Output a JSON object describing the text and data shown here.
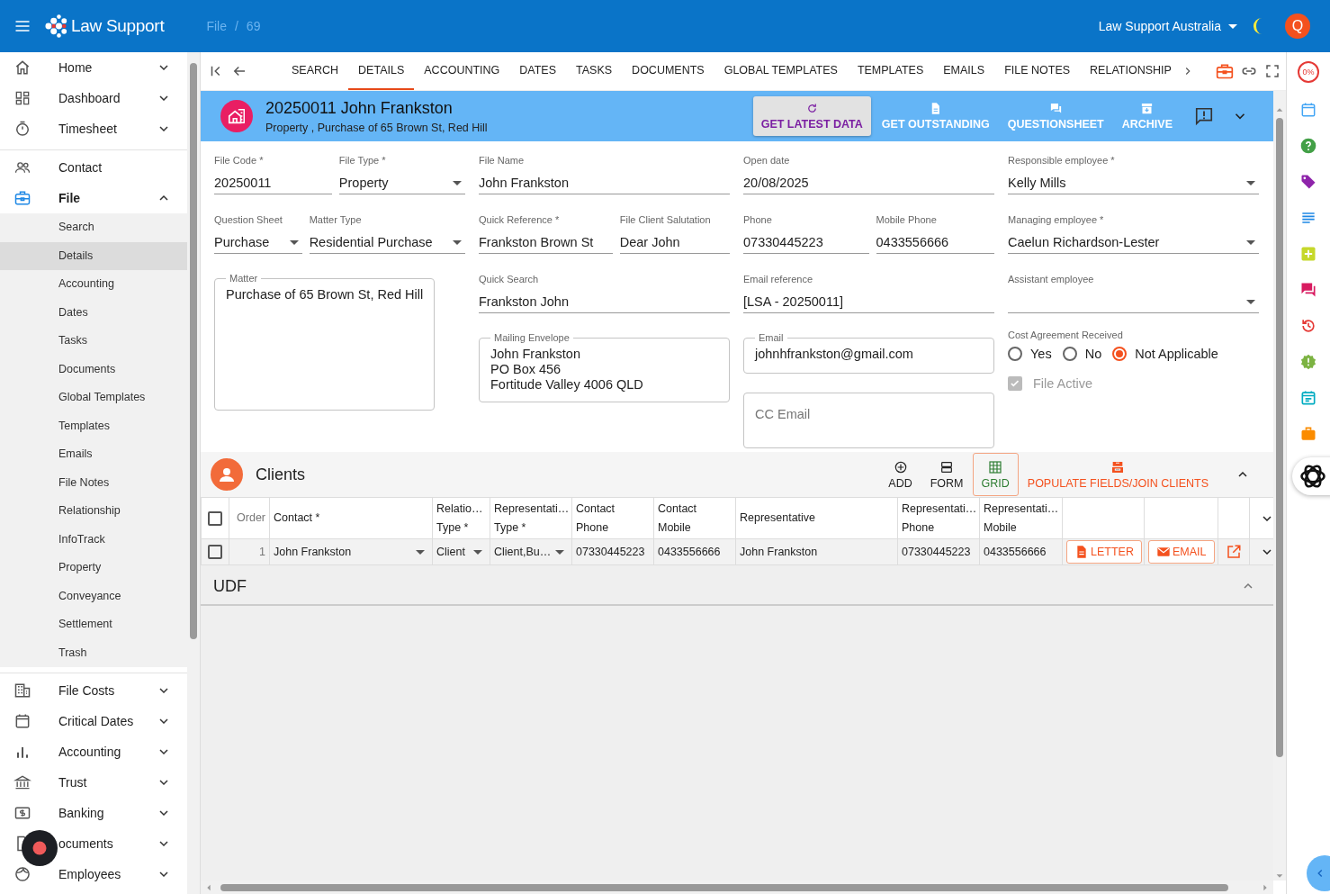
{
  "header": {
    "brand": "Law Support",
    "breadcrumb": [
      "File",
      "69"
    ],
    "separator": "/",
    "organization": "Law Support Australia",
    "avatar": "Q"
  },
  "sidebar": {
    "items": [
      {
        "label": "Home",
        "kind": "group",
        "expanded": false
      },
      {
        "label": "Dashboard",
        "kind": "group",
        "expanded": false
      },
      {
        "label": "Timesheet",
        "kind": "group",
        "expanded": false
      },
      {
        "label": "Contact",
        "kind": "link"
      },
      {
        "label": "File",
        "kind": "group",
        "expanded": true,
        "children": [
          {
            "label": "Search",
            "selected": false
          },
          {
            "label": "Details",
            "selected": true
          },
          {
            "label": "Accounting",
            "selected": false
          },
          {
            "label": "Dates",
            "selected": false
          },
          {
            "label": "Tasks",
            "selected": false
          },
          {
            "label": "Documents",
            "selected": false
          },
          {
            "label": "Global Templates",
            "selected": false
          },
          {
            "label": "Templates",
            "selected": false
          },
          {
            "label": "Emails",
            "selected": false
          },
          {
            "label": "File Notes",
            "selected": false
          },
          {
            "label": "Relationship",
            "selected": false
          },
          {
            "label": "InfoTrack",
            "selected": false
          },
          {
            "label": "Property",
            "selected": false
          },
          {
            "label": "Conveyance",
            "selected": false
          },
          {
            "label": "Settlement",
            "selected": false
          },
          {
            "label": "Trash",
            "selected": false
          }
        ]
      },
      {
        "label": "File Costs",
        "kind": "group",
        "expanded": false
      },
      {
        "label": "Critical Dates",
        "kind": "group",
        "expanded": false
      },
      {
        "label": "Accounting",
        "kind": "group",
        "expanded": false
      },
      {
        "label": "Trust",
        "kind": "group",
        "expanded": false
      },
      {
        "label": "Banking",
        "kind": "group",
        "expanded": false
      },
      {
        "label": "ocuments",
        "kind": "group",
        "expanded": false
      },
      {
        "label": "Employees",
        "kind": "group",
        "expanded": false
      }
    ]
  },
  "tabs": [
    {
      "label": "SEARCH",
      "selected": false
    },
    {
      "label": "DETAILS",
      "selected": true
    },
    {
      "label": "ACCOUNTING",
      "selected": false
    },
    {
      "label": "DATES",
      "selected": false
    },
    {
      "label": "TASKS",
      "selected": false
    },
    {
      "label": "DOCUMENTS",
      "selected": false
    },
    {
      "label": "GLOBAL TEMPLATES",
      "selected": false
    },
    {
      "label": "TEMPLATES",
      "selected": false
    },
    {
      "label": "EMAILS",
      "selected": false
    },
    {
      "label": "FILE NOTES",
      "selected": false
    },
    {
      "label": "RELATIONSHIP",
      "selected": false
    }
  ],
  "banner": {
    "title": "20250011 John Frankston",
    "subtitle": "Property , Purchase of 65 Brown St, Red Hill",
    "actions": [
      {
        "label": "GET LATEST DATA",
        "active": true
      },
      {
        "label": "GET OUTSTANDING",
        "active": false
      },
      {
        "label": "QUESTIONSHEET",
        "active": false
      },
      {
        "label": "ARCHIVE",
        "active": false
      }
    ]
  },
  "form": {
    "columns": [
      [
        [
          {
            "kind": "text",
            "label": "File Code *",
            "value": "20250011"
          },
          {
            "kind": "select",
            "label": "File Type *",
            "value": "Property"
          }
        ],
        [
          {
            "kind": "select",
            "label": "Question Sheet",
            "value": "Purchase"
          },
          {
            "kind": "select",
            "label": "Matter Type",
            "value": "Residential Purchase"
          }
        ],
        [
          {
            "kind": "textarea",
            "label": "Matter",
            "value": "Purchase of 65 Brown St, Red Hill"
          }
        ]
      ],
      [
        [
          {
            "kind": "text",
            "label": "File Name",
            "value": "John Frankston"
          }
        ],
        [
          {
            "kind": "text",
            "label": "Quick Reference *",
            "value": "Frankston Brown St"
          },
          {
            "kind": "text",
            "label": "File Client Salutation",
            "value": "Dear John"
          }
        ],
        [
          {
            "kind": "text",
            "label": "Quick Search",
            "value": "Frankston John"
          }
        ],
        [
          {
            "kind": "outlined",
            "label": "Mailing Envelope",
            "value": "John Frankston\nPO Box 456\nFortitude Valley 4006 QLD"
          }
        ]
      ],
      [
        [
          {
            "kind": "text",
            "label": "Open date",
            "value": "20/08/2025"
          }
        ],
        [
          {
            "kind": "text",
            "label": "Phone",
            "value": "07330445223"
          },
          {
            "kind": "text",
            "label": "Mobile Phone",
            "value": "0433556666"
          }
        ],
        [
          {
            "kind": "text",
            "label": "Email reference",
            "value": "[LSA - 20250011]"
          }
        ],
        [
          {
            "kind": "outlined",
            "label": "Email",
            "value": "johnhfrankston@gmail.com"
          }
        ],
        [
          {
            "kind": "outlined",
            "placeholder": "CC Email"
          }
        ]
      ],
      [
        [
          {
            "kind": "select",
            "label": "Responsible employee *",
            "value": "Kelly Mills"
          }
        ],
        [
          {
            "kind": "select",
            "label": "Managing employee *",
            "value": "Caelun Richardson-Lester"
          }
        ],
        [
          {
            "kind": "select",
            "label": "Assistant employee"
          }
        ],
        [
          {
            "kind": "radio",
            "label": "Cost Agreement Received",
            "options": [
              {
                "label": "Yes",
                "selected": false
              },
              {
                "label": "No",
                "selected": false
              },
              {
                "label": "Not Applicable",
                "selected": true
              }
            ]
          }
        ],
        [
          {
            "kind": "checkbox",
            "label": "File Active",
            "checked": true,
            "disabled": true
          }
        ]
      ]
    ]
  },
  "clients": {
    "title": "Clients",
    "actions": [
      {
        "label": "ADD",
        "kind": "tool",
        "selected": false
      },
      {
        "label": "FORM",
        "kind": "tool",
        "selected": false
      },
      {
        "label": "GRID",
        "kind": "tool",
        "selected": true
      },
      {
        "label": "POPULATE FIELDS/JOIN CLIENTS",
        "kind": "accent",
        "selected": false
      }
    ],
    "table": {
      "checked": false,
      "columns": [
        "Order",
        "Contact *",
        "Relatio…\nType *",
        "Representati…\nType *",
        "Contact\nPhone",
        "Contact\nMobile",
        "Representative",
        "Representati…\nPhone",
        "Representati…\nMobile"
      ],
      "rows": [
        {
          "selected": false,
          "cells": [
            {
              "kind": "order",
              "text": "1"
            },
            {
              "kind": "select",
              "text": "John Frankston"
            },
            {
              "kind": "select",
              "text": "Client"
            },
            {
              "kind": "select",
              "text": "Client,Bu…"
            },
            {
              "kind": "text",
              "text": "07330445223"
            },
            {
              "kind": "text",
              "text": "0433556666"
            },
            {
              "kind": "text",
              "text": "John Frankston"
            },
            {
              "kind": "text",
              "text": "07330445223"
            },
            {
              "kind": "text",
              "text": "0433556666"
            }
          ],
          "actions": [
            {
              "label": "LETTER"
            },
            {
              "label": "EMAIL"
            }
          ]
        }
      ]
    }
  },
  "udf": {
    "title": "UDF"
  },
  "rail": {
    "progress": "0%"
  }
}
